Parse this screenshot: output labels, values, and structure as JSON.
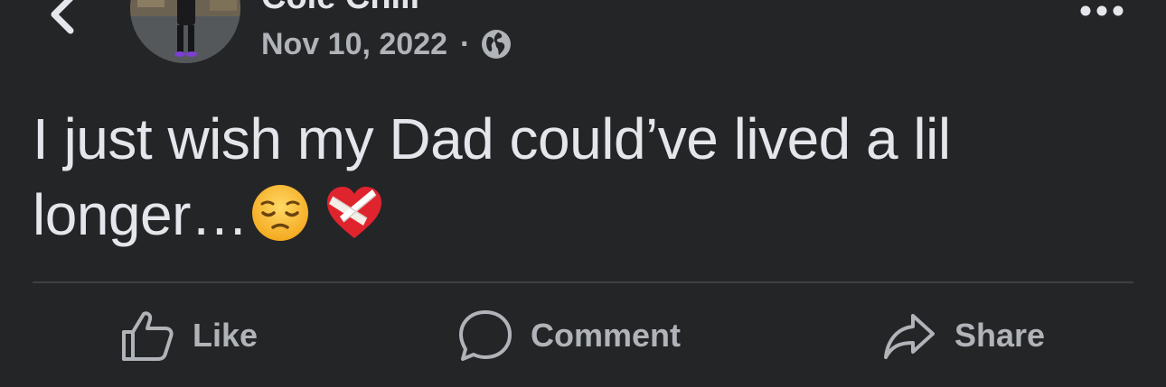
{
  "header": {
    "author_name": "Cole Chill",
    "timestamp": "Nov 10, 2022",
    "separator": "·",
    "audience_icon": "globe-icon",
    "back_icon": "chevron-left-icon",
    "more_icon": "more-horizontal-icon"
  },
  "post": {
    "text": "I just wish my Dad could’ve lived a lil longer…",
    "emojis": [
      "pensive-face-emoji",
      "mending-heart-emoji"
    ]
  },
  "actions": {
    "like_label": "Like",
    "comment_label": "Comment",
    "share_label": "Share"
  },
  "colors": {
    "background": "#242526",
    "primary_text": "#e4e6eb",
    "secondary_text": "#b0b3b8",
    "divider": "#3e4042"
  }
}
